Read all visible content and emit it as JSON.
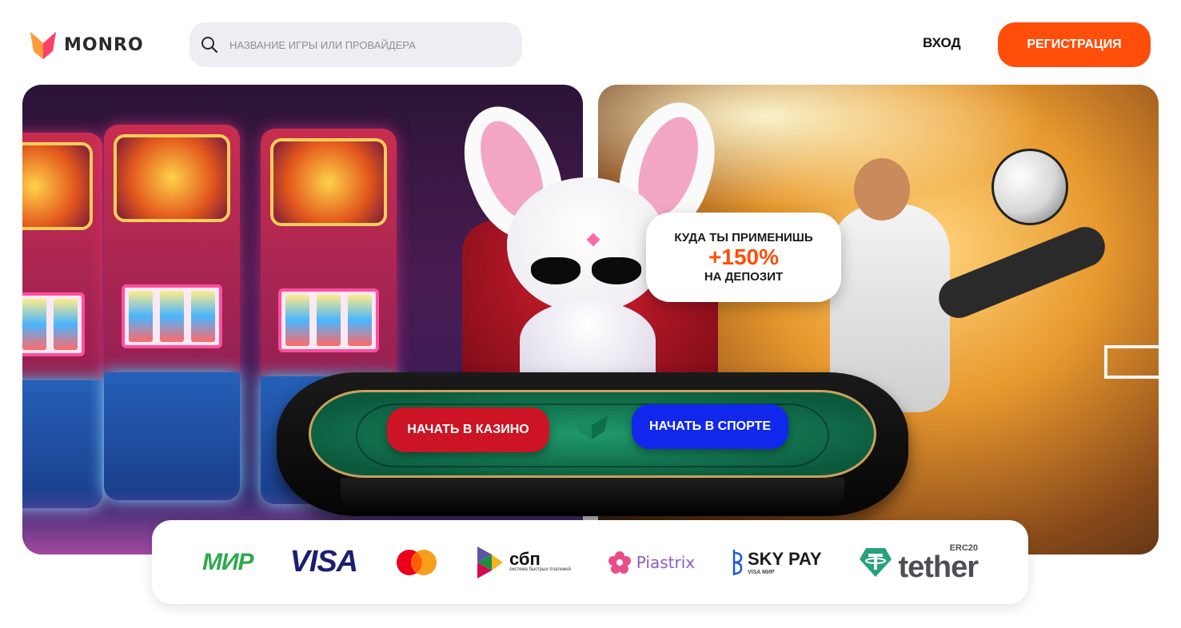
{
  "header": {
    "brand": "MONRO",
    "search_placeholder": "НАЗВАНИЕ ИГРЫ ИЛИ ПРОВАЙДЕРА",
    "login_label": "ВХОД",
    "register_label": "РЕГИСТРАЦИЯ"
  },
  "promo": {
    "line1": "КУДА ТЫ ПРИМЕНИШЬ",
    "bonus": "+150%",
    "line3": "НА ДЕПОЗИТ"
  },
  "actions": {
    "casino_label": "НАЧАТЬ В КАЗИНО",
    "sport_label": "НАЧАТЬ В СПОРТЕ"
  },
  "payments": {
    "mir": "МИР",
    "visa": "VISA",
    "sbp": "сбп",
    "sbp_sub": "система быстрых платежей",
    "piastrix": "Piastrix",
    "skypay": "SKY PAY",
    "skypay_sub": "VISA МИР",
    "tether": "tether",
    "tether_badge": "ERC20"
  },
  "colors": {
    "accent": "#ff4e0a",
    "casino_button": "#cc1424",
    "sport_button": "#1128ec"
  }
}
